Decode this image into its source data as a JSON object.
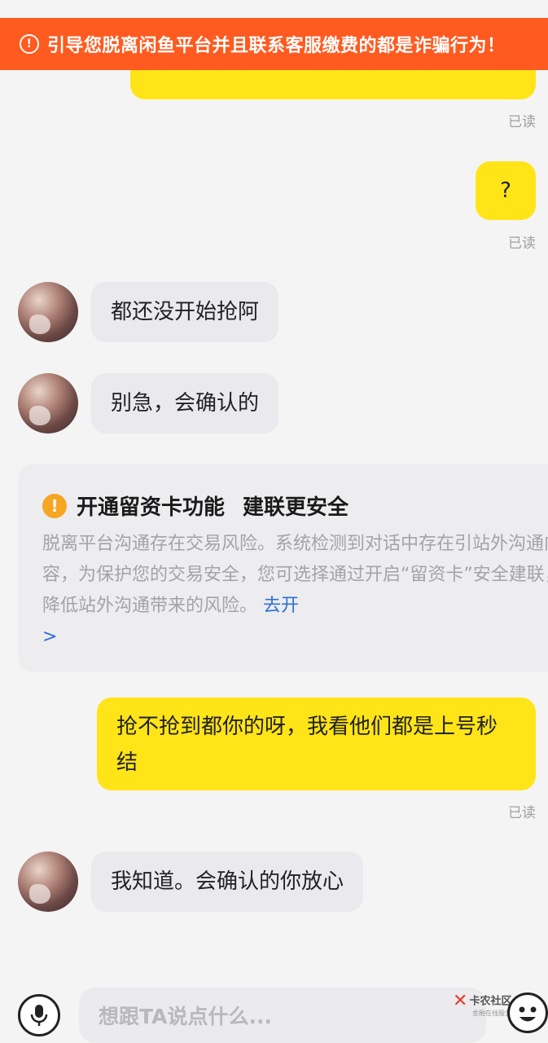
{
  "banner": {
    "text": "引导您脱离闲鱼平台并且联系客服缴费的都是诈骗行为！"
  },
  "messages": [
    {
      "from": "me",
      "text": "",
      "status": "已读"
    },
    {
      "from": "me",
      "text": "?",
      "status": "已读"
    },
    {
      "from": "them",
      "text": "都还没开始抢阿"
    },
    {
      "from": "them",
      "text": "别急，会确认的"
    },
    {
      "from": "me",
      "text": "抢不抢到都你的呀，我看他们都是上号秒结",
      "status": "已读"
    },
    {
      "from": "them",
      "text": "我知道。会确认的你放心"
    }
  ],
  "safety_card": {
    "title_left": "开通留资卡功能",
    "title_right": "建联更安全",
    "body": "脱离平台沟通存在交易风险。系统检测到对话中存在引站外沟通内容，为保护您的交易安全，您可选择通过开启“留资卡”安全建联，降低站外沟通带来的风险。",
    "link": "去开",
    "chevron": ">"
  },
  "input": {
    "placeholder": "想跟TA说点什么..."
  },
  "watermark": {
    "name": "卡农社区",
    "slogan": "金融在线服务"
  },
  "colors": {
    "banner": "#ff5a1f",
    "my_bubble": "#ffe418",
    "their_bubble": "#e9e9ee",
    "link": "#2f6fd4",
    "warning_icon": "#f7a623"
  },
  "icons": [
    "warning-icon",
    "exclamation-icon",
    "microphone-icon",
    "emoji-icon"
  ]
}
